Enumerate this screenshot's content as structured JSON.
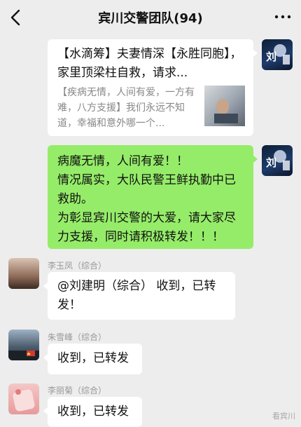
{
  "header": {
    "title": "宾川交警团队(94)"
  },
  "messages": {
    "link_card": {
      "title": "【水滴筹】夫妻情深【永胜同胞】，家里顶梁柱自救，请求...",
      "desc": "【疾病无情，人间有爱，一方有难，八方支援】我们永远不知道，幸福和意外哪一个..."
    },
    "green_msg": {
      "line1": "病魔无情，人间有爱！！",
      "line2": "情况属实，大队民警王鲜执勤中已救助。",
      "line3": "为彰显宾川交警的大爱，请大家尽力支援，同时请积极转发！！！"
    },
    "msg1": {
      "sender": "李玉凤（综合）",
      "text": "@刘建明（综合） 收到，已转发！"
    },
    "msg2": {
      "sender": "朱雪峰（综合）",
      "text": "收到，已转发"
    },
    "msg3": {
      "sender": "李丽菊（综合）",
      "text": "收到，已转发"
    }
  },
  "avatar_text": "刘",
  "watermark": "看宾川",
  "colors": {
    "background": "#ededed",
    "own_bubble": "#95ec69",
    "other_bubble": "#ffffff"
  }
}
